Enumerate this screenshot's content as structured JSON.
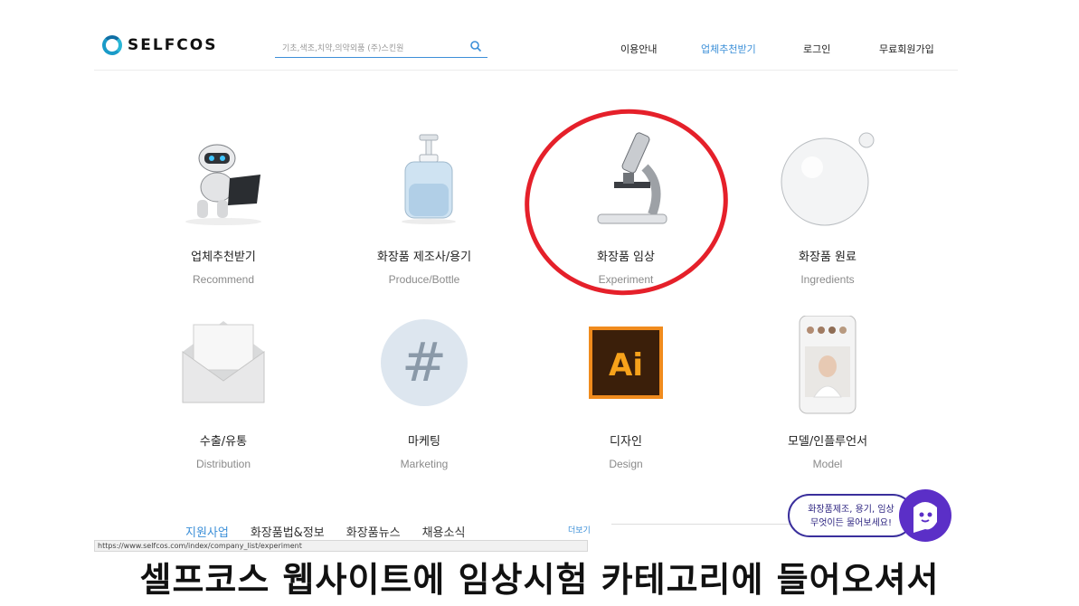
{
  "header": {
    "logo_text": "SELFCOS",
    "search_placeholder": "기초,색조,치약,의약외품 (주)스킨원",
    "nav": [
      "이용안내",
      "업체추천받기",
      "로그인",
      "무료회원가입"
    ],
    "active_nav": "업체추천받기"
  },
  "categories": [
    {
      "title": "업체추천받기",
      "subtitle": "Recommend",
      "icon": "robot-laptop-icon"
    },
    {
      "title": "화장품 제조사/용기",
      "subtitle": "Produce/Bottle",
      "icon": "pump-bottle-icon"
    },
    {
      "title": "화장품 임상",
      "subtitle": "Experiment",
      "icon": "microscope-icon"
    },
    {
      "title": "화장품 원료",
      "subtitle": "Ingredients",
      "icon": "bubble-icon"
    },
    {
      "title": "수출/유통",
      "subtitle": "Distribution",
      "icon": "envelope-icon"
    },
    {
      "title": "마케팅",
      "subtitle": "Marketing",
      "icon": "hashtag-icon"
    },
    {
      "title": "디자인",
      "subtitle": "Design",
      "icon": "illustrator-icon"
    },
    {
      "title": "모델/인플루언서",
      "subtitle": "Model",
      "icon": "phone-model-icon"
    }
  ],
  "icon_ai_text": "Ai",
  "icon_hash_text": "#",
  "tabs": [
    "지원사업",
    "화장품법&정보",
    "화장품뉴스",
    "채용소식"
  ],
  "more_label": "더보기",
  "status_url": "https://www.selfcos.com/index/company_list/experiment",
  "chat": {
    "line1": "화장품제조, 용기, 임상",
    "line2": "무엇이든 물어보세요!"
  },
  "caption": "셀프코스 웹사이트에 임상시험 카테고리에 들어오셔서",
  "colors": {
    "accent": "#3b8fd8",
    "annotation": "#e5202a",
    "chat": "#5b2fc7"
  }
}
